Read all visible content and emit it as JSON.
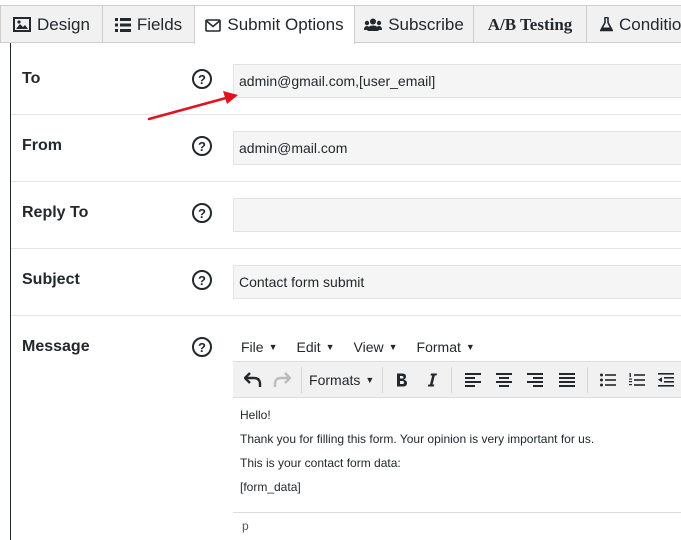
{
  "tabs": [
    {
      "label": "Design",
      "icon": "image-icon"
    },
    {
      "label": "Fields",
      "icon": "list-icon"
    },
    {
      "label": "Submit Options",
      "icon": "envelope-icon",
      "active": true
    },
    {
      "label": "Subscribe",
      "icon": "users-icon"
    },
    {
      "label": "A/B Testing",
      "icon": "ab-icon"
    },
    {
      "label": "Conditio",
      "icon": "flask-icon"
    }
  ],
  "fields": {
    "to": {
      "label": "To",
      "value": "admin@gmail.com,[user_email]"
    },
    "from": {
      "label": "From",
      "value": "admin@mail.com"
    },
    "reply_to": {
      "label": "Reply To",
      "value": ""
    },
    "subject": {
      "label": "Subject",
      "value": "Contact form submit"
    },
    "message": {
      "label": "Message"
    }
  },
  "help_glyph": "?",
  "editor": {
    "menu": [
      "File",
      "Edit",
      "View",
      "Format"
    ],
    "formats_label": "Formats",
    "content": [
      "Hello!",
      "Thank you for filling this form. Your opinion is very important for us.",
      "This is your contact form data:",
      "[form_data]"
    ],
    "status_path": "p"
  },
  "colors": {
    "annotation_arrow": "#e0141e",
    "tab_bg": "#f1f1f1",
    "field_bg": "#f5f5f5"
  }
}
